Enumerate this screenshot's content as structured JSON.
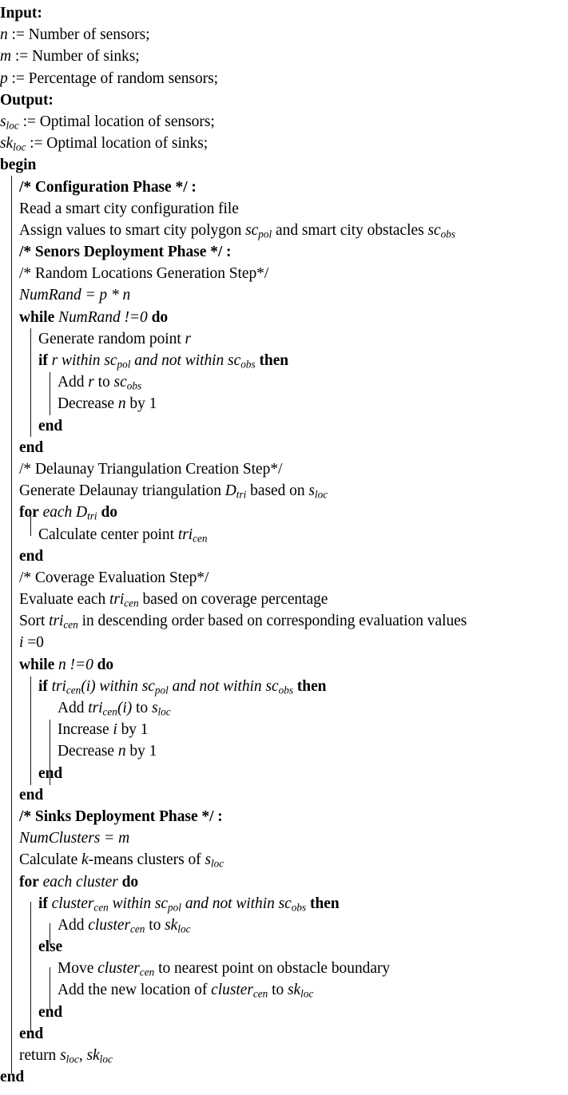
{
  "algorithm": {
    "sections": {
      "input_label": "Input:",
      "output_label": "Output:",
      "begin_label": "begin",
      "end_label": "end"
    },
    "input_params": [
      {
        "var": "n",
        "text": ":= Number of sensors;"
      },
      {
        "var": "m",
        "text": ":= Number of sinks;"
      },
      {
        "var": "p",
        "text": ":= Percentage of random sensors;"
      }
    ],
    "output_params": [
      {
        "var": "s",
        "sub": "loc",
        "text": ":= Optimal location of sensors;"
      },
      {
        "var": "sk",
        "sub": "loc",
        "text": ":= Optimal location of sinks;"
      }
    ],
    "comments": {
      "configuration_phase": "/* Configuration Phase */ :",
      "sensors_deployment_phase": "/* Senors Deployment Phase */ :",
      "random_locations_step": "/* Random Locations Generation Step*/",
      "delaunay_step": "/* Delaunay Triangulation Creation Step*/",
      "coverage_step": "/* Coverage Evaluation Step*/",
      "sinks_deployment_phase": "/* Sinks Deployment Phase */ :"
    },
    "statements": {
      "read_config": "Read a smart city configuration file",
      "assign_values_pre": "Assign values to smart city polygon",
      "assign_values_mid": "and smart city obstacles",
      "num_rand_assign_lhs": "NumRand",
      "num_rand_assign_rhs": "= p * n",
      "generate_random_point": "Generate random point",
      "generate_random_point_var": "r",
      "add_r_to": "Add",
      "add_r_to_mid": "to",
      "decrease_n": "Decrease",
      "decrease_n_mid": "by 1",
      "increase_i": "Increase",
      "increase_i_mid": "by 1",
      "generate_delaunay_pre": "Generate Delaunay triangulation",
      "generate_delaunay_mid": "based on",
      "calculate_center_point": "Calculate center point",
      "evaluate_each_pre": "Evaluate each",
      "evaluate_each_post": "based on coverage percentage",
      "sort_pre": "Sort",
      "sort_post": "in descending order based on corresponding evaluation values",
      "i_init": "i",
      "i_init_val": "=0",
      "add_tricen_pre": "Add",
      "add_tricen_mid": "to",
      "num_clusters_lhs": "NumClusters",
      "num_clusters_rhs": "= m",
      "calculate_kmeans_pre": "Calculate",
      "calculate_kmeans_k": "k",
      "calculate_kmeans_mid": "-means clusters of",
      "add_cluster_pre": "Add",
      "add_cluster_mid": "to",
      "move_cluster_pre": "Move",
      "move_cluster_post": "to nearest point on obstacle boundary",
      "add_new_location_pre": "Add the new location of",
      "add_new_location_mid": "to",
      "return_kw": "return",
      "return_sep": ","
    },
    "keywords": {
      "while": "while",
      "do": "do",
      "if": "if",
      "then": "then",
      "else": "else",
      "end": "end",
      "for": "for",
      "each": "each"
    },
    "conditions": {
      "while_numrand": "NumRand",
      "while_numrand_cmp": "!=0",
      "while_n": "n",
      "while_n_cmp": "!=0",
      "within": "within",
      "and_not_within": "and not within",
      "for_each_dtri": "each",
      "for_each_cluster": "each cluster"
    },
    "variables": {
      "n": "n",
      "m": "m",
      "p": "p",
      "r": "r",
      "i": "i",
      "s_loc": "s",
      "sk_loc": "sk",
      "sc_pol": "sc",
      "sc_obs": "sc",
      "d_tri": "D",
      "tri_cen": "tri",
      "cluster_cen": "cluster",
      "sub_loc": "loc",
      "sub_pol": "pol",
      "sub_obs": "obs",
      "sub_tri": "tri",
      "sub_cen": "cen",
      "tri_cen_i": "(i)"
    },
    "colors": {
      "text": "#000000",
      "rule": "#1a1a1a",
      "background": "#ffffff"
    }
  }
}
